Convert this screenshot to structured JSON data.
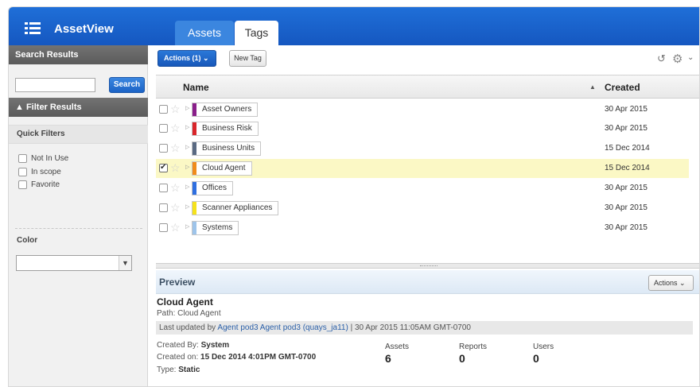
{
  "app": {
    "title": "AssetView"
  },
  "tabs": [
    {
      "label": "Assets",
      "active": false
    },
    {
      "label": "Tags",
      "active": true
    }
  ],
  "sidebar": {
    "search_results_header": "Search Results",
    "search_button": "Search",
    "search_value": "",
    "filter_header": "▲ Filter Results",
    "quick_filters_label": "Quick Filters",
    "quick_filters": [
      {
        "label": "Not In Use",
        "checked": false
      },
      {
        "label": "In scope",
        "checked": false
      },
      {
        "label": "Favorite",
        "checked": false
      }
    ],
    "color_label": "Color",
    "color_value": ""
  },
  "toolbar": {
    "actions_label": "Actions (1) ⌄",
    "new_tag_label": "New Tag",
    "refresh_icon": "refresh-icon",
    "settings_icon": "gear-icon"
  },
  "table": {
    "columns": {
      "name": "Name",
      "created": "Created"
    },
    "sort_indicator": "▲",
    "rows": [
      {
        "name": "Asset Owners",
        "color": "#8a1f8a",
        "created": "30 Apr 2015",
        "checked": false,
        "selected": false
      },
      {
        "name": "Business Risk",
        "color": "#d9262b",
        "created": "30 Apr 2015",
        "checked": false,
        "selected": false
      },
      {
        "name": "Business Units",
        "color": "#5a6a82",
        "created": "15 Dec 2014",
        "checked": false,
        "selected": false
      },
      {
        "name": "Cloud Agent",
        "color": "#f08c1c",
        "created": "15 Dec 2014",
        "checked": true,
        "selected": true
      },
      {
        "name": "Offices",
        "color": "#2f6fe0",
        "created": "30 Apr 2015",
        "checked": false,
        "selected": false
      },
      {
        "name": "Scanner Appliances",
        "color": "#f5e21c",
        "created": "30 Apr 2015",
        "checked": false,
        "selected": false
      },
      {
        "name": "Systems",
        "color": "#9ec4ea",
        "created": "30 Apr 2015",
        "checked": false,
        "selected": false
      }
    ]
  },
  "preview": {
    "header": "Preview",
    "actions_label": "Actions ⌄",
    "name": "Cloud Agent",
    "path": "Path: Cloud Agent",
    "updated_prefix": "Last updated by ",
    "updated_by": "Agent pod3 Agent pod3 (quays_ja11)",
    "updated_suffix": " | 30 Apr 2015 11:05AM GMT-0700",
    "created_by_label": "Created By:",
    "created_by": "System",
    "created_on_label": "Created on:",
    "created_on": "15 Dec 2014 4:01PM GMT-0700",
    "type_label": "Type:",
    "type": "Static",
    "stats": [
      {
        "label": "Assets",
        "value": "6"
      },
      {
        "label": "Reports",
        "value": "0"
      },
      {
        "label": "Users",
        "value": "0"
      }
    ]
  }
}
